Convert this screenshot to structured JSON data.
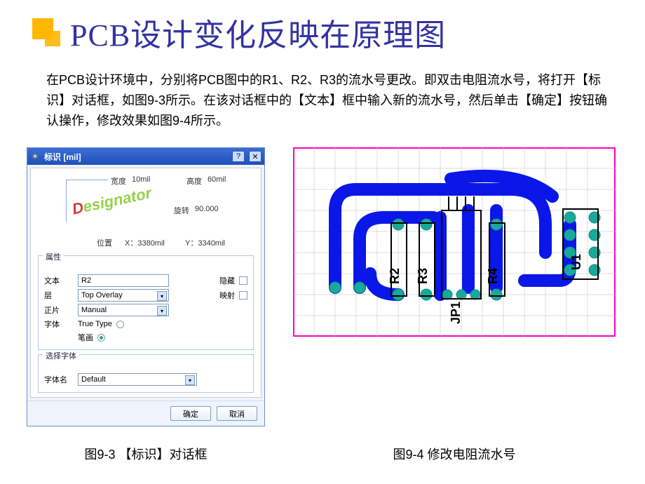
{
  "slide": {
    "title": "PCB设计变化反映在原理图",
    "body": "在PCB设计环境中，分别将PCB图中的R1、R2、R3的流水号更改。即双击电阻流水号，将打开【标识】对话框，如图9-3所示。在该对话框中的【文本】框中输入新的流水号，然后单击【确定】按钮确认操作，修改效果如图9-4所示。"
  },
  "dialog": {
    "title": "标识 [mil]",
    "preview_word": "Designator",
    "dims": {
      "width_label": "宽度",
      "width_value": "10mil",
      "height_label": "高度",
      "height_value": "60mil",
      "rotate_label": "旋转",
      "rotate_value": "90.000",
      "pos_label": "位置",
      "pos_x": "X：3380mil",
      "pos_y": "Y：3340mil"
    },
    "group_props": "属性",
    "props": {
      "text_label": "文本",
      "text_value": "R2",
      "layer_label": "层",
      "layer_value": "Top Overlay",
      "mirror_label": "映射",
      "hide_label": "隐藏",
      "just_label": "正片",
      "just_value": "Manual",
      "font_label": "字体",
      "font_opt_tt": "True Type",
      "font_opt_stroke": "笔画"
    },
    "group_font": "选择字体",
    "font": {
      "name_label": "字体名",
      "name_value": "Default"
    },
    "buttons": {
      "ok": "确定",
      "cancel": "取消"
    }
  },
  "pcb": {
    "refs": {
      "r2": "R2",
      "r3": "R3",
      "r4": "R4",
      "jp1": "JP1",
      "u1": "U1"
    }
  },
  "captions": {
    "fig1": "图9-3 【标识】对话框",
    "fig2": "图9-4  修改电阻流水号"
  }
}
